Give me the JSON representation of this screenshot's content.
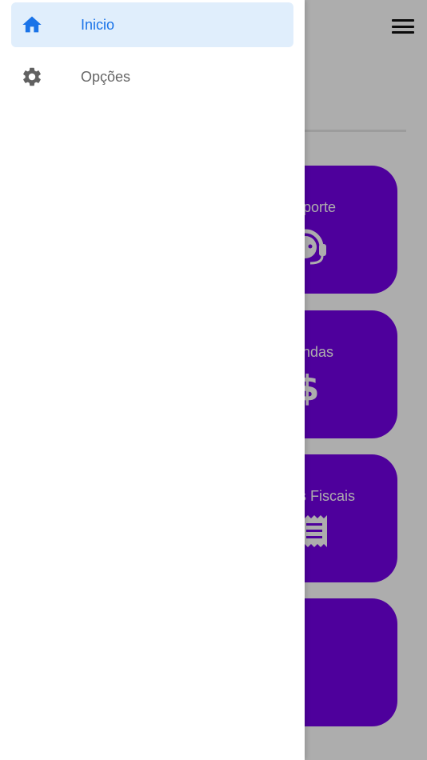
{
  "drawer": {
    "items": [
      {
        "label": "Inicio",
        "icon": "home-icon",
        "active": true
      },
      {
        "label": "Opções",
        "icon": "gear-icon",
        "active": false
      }
    ]
  },
  "tiles": [
    {
      "label": "Suporte",
      "icon": "support-agent-icon"
    },
    {
      "label": "Vendas",
      "icon": "currency-brl-icon",
      "icon_text": "R$"
    },
    {
      "label": "Notas Fiscais",
      "icon": "receipt-icon"
    },
    {
      "label": "",
      "icon": ""
    }
  ],
  "colors": {
    "accent": "#1a73e8",
    "active_bg": "#e0eefc",
    "tile_bg": "#7300e6",
    "icon_gray": "#616161"
  }
}
